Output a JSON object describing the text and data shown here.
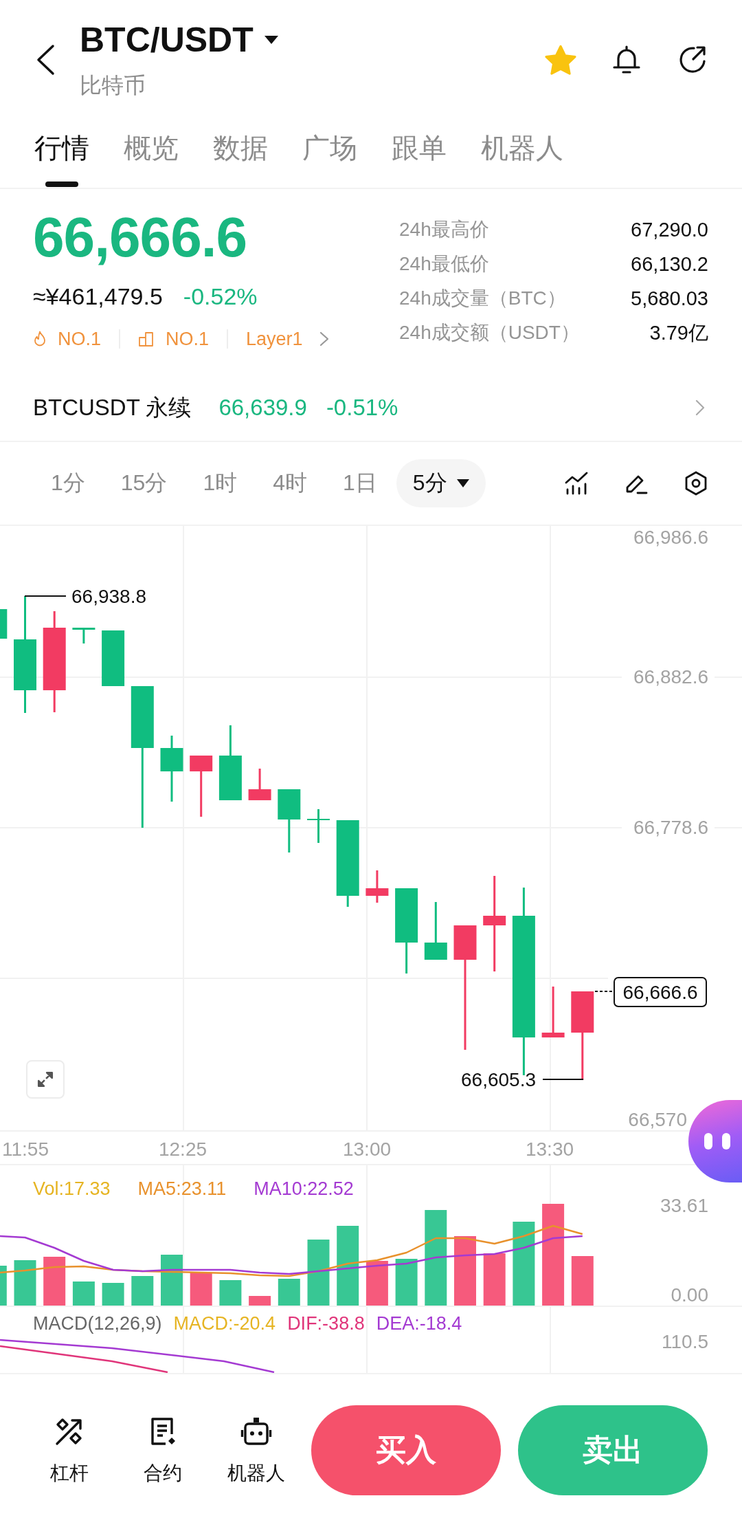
{
  "header": {
    "title": "BTC/USDT",
    "subtitle": "比特币",
    "favorite": true
  },
  "tabs": [
    {
      "label": "行情",
      "selected": true
    },
    {
      "label": "概览",
      "selected": false
    },
    {
      "label": "数据",
      "selected": false
    },
    {
      "label": "广场",
      "selected": false
    },
    {
      "label": "跟单",
      "selected": false
    },
    {
      "label": "机器人",
      "selected": false
    }
  ],
  "ticker": {
    "price": "66,666.6",
    "fiat_price": "≈¥461,479.5",
    "change": "-0.52%",
    "tags": [
      {
        "kind": "hot",
        "label": "NO.1"
      },
      {
        "kind": "rank",
        "label": "NO.1"
      },
      {
        "kind": "sector",
        "label": "Layer1"
      }
    ]
  },
  "stats": [
    {
      "label": "24h最高价",
      "value": "67,290.0"
    },
    {
      "label": "24h最低价",
      "value": "66,130.2"
    },
    {
      "label": "24h成交量（BTC）",
      "value": "5,680.03"
    },
    {
      "label": "24h成交额（USDT）",
      "value": "3.79亿"
    }
  ],
  "perpetual": {
    "name": "BTCUSDT 永续",
    "price": "66,639.9",
    "change": "-0.51%"
  },
  "intervals": [
    {
      "label": "1分",
      "selected": false
    },
    {
      "label": "15分",
      "selected": false
    },
    {
      "label": "1时",
      "selected": false
    },
    {
      "label": "4时",
      "selected": false
    },
    {
      "label": "1日",
      "selected": false
    },
    {
      "label": "5分",
      "selected": true
    }
  ],
  "chart": {
    "price_axis": [
      "66,986.6",
      "66,882.6",
      "66,778.6",
      "66,570"
    ],
    "high_label": "66,938.8",
    "low_label": "66,605.3",
    "last_price": "66,666.6",
    "time_axis": [
      "11:55",
      "12:25",
      "13:00",
      "13:30"
    ]
  },
  "volume": {
    "legend": [
      {
        "label": "Vol:17.33",
        "color": "#e6b422"
      },
      {
        "label": "MA5:23.11",
        "color": "#e8912c"
      },
      {
        "label": "MA10:22.52",
        "color": "#a43ad2"
      }
    ],
    "axis": [
      "33.61",
      "0.00"
    ]
  },
  "macd": {
    "legend": [
      {
        "label": "MACD(12,26,9)",
        "color": "#666666"
      },
      {
        "label": "MACD:-20.4",
        "color": "#e6b422"
      },
      {
        "label": "DIF:-38.8",
        "color": "#e0357a"
      },
      {
        "label": "DEA:-18.4",
        "color": "#a43ad2"
      }
    ],
    "axis": [
      "110.5"
    ]
  },
  "actions": [
    {
      "kind": "leverage",
      "label": "杠杆"
    },
    {
      "kind": "contract",
      "label": "合约"
    },
    {
      "kind": "bot",
      "label": "机器人"
    }
  ],
  "trade_buttons": [
    {
      "kind": "buy",
      "label": "买入"
    },
    {
      "kind": "sell",
      "label": "卖出"
    }
  ]
}
